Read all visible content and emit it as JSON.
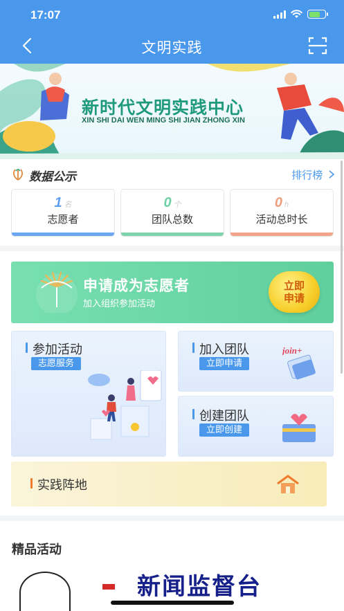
{
  "status_bar": {
    "time": "17:07"
  },
  "nav": {
    "title": "文明实践"
  },
  "banner": {
    "title": "新时代文明实践中心",
    "subtitle": "XIN SHI DAI WEN MING SHI JIAN ZHONG XIN"
  },
  "data_section": {
    "title": "数据公示",
    "rank_link": "排行榜",
    "stats": [
      {
        "value": "1",
        "unit": "名",
        "label": "志愿者",
        "color": "#5f9ff0"
      },
      {
        "value": "0",
        "unit": "个",
        "label": "团队总数",
        "color": "#6fcfa5"
      },
      {
        "value": "0",
        "unit": "h",
        "label": "活动总时长",
        "color": "#f0a080"
      }
    ]
  },
  "apply": {
    "title": "申请成为志愿者",
    "subtitle": "加入组织参加活动",
    "button_line1": "立即",
    "button_line2": "申请"
  },
  "tiles": {
    "join_activity": {
      "title": "参加活动",
      "tag": "志愿服务"
    },
    "join_team": {
      "title": "加入团队",
      "tag": "立即申请",
      "icon_text": "join+"
    },
    "create_team": {
      "title": "创建团队",
      "tag": "立即创建"
    },
    "practice_base": {
      "title": "实践阵地"
    }
  },
  "quality": {
    "title": "精品活动",
    "first_item_title": "新闻监督台"
  },
  "colors": {
    "primary": "#4a98ec",
    "green": "#5fcf9d",
    "accent_orange": "#f07a2d"
  }
}
